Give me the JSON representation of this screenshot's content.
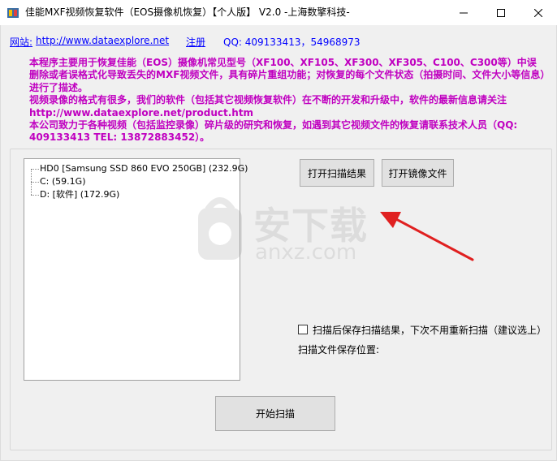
{
  "window": {
    "title": "佳能MXF视频恢复软件（EOS摄像机恢复）【个人版】 V2.0  -上海数擎科技-",
    "minimize_glyph": "—",
    "maximize_glyph": "☐",
    "close_glyph": "✕"
  },
  "topbar": {
    "site_label": "网站:",
    "site_url": "http://www.dataexplore.net",
    "register": "注册",
    "qq": "QQ: 409133413，54968973"
  },
  "intro": {
    "p1": "本程序主要用于恢复佳能（EOS）摄像机常见型号（XF100、XF105、XF300、XF305、C100、C300等）中误删除或者误格式化导致丢失的MXF视频文件，具有碎片重组功能；对恢复的每个文件状态（拍摄时间、文件大小等信息）进行了描述。",
    "p2": "视频录像的格式有很多，我们的软件（包括其它视频恢复软件）在不断的开发和升级中，软件的最新信息请关注 http://www.dataexplore.net/product.htm",
    "p3": "本公司致力于各种视频（包括监控录像）碎片级的研究和恢复，如遇到其它视频文件的恢复请联系技术人员（QQ: 409133413  TEL: 13872883452）。"
  },
  "tree": {
    "items": [
      {
        "label": "HD0    [Samsung SSD 860 EVO 250GB]  (232.9G)"
      },
      {
        "label": "C:      (59.1G)"
      },
      {
        "label": "D:   [软件]  (172.9G)"
      }
    ]
  },
  "buttons": {
    "open_result": "打开扫描结果",
    "open_image": "打开镜像文件",
    "start_scan": "开始扫描"
  },
  "options": {
    "save_result_label": "扫描后保存扫描结果，下次不用重新扫描（建议选上）",
    "save_location_label": "扫描文件保存位置:"
  },
  "watermark": {
    "text": "安下载",
    "sub": "anxz.com"
  },
  "colors": {
    "intro_text": "#c000c0",
    "link": "#0000ff",
    "arrow": "#e02020"
  }
}
